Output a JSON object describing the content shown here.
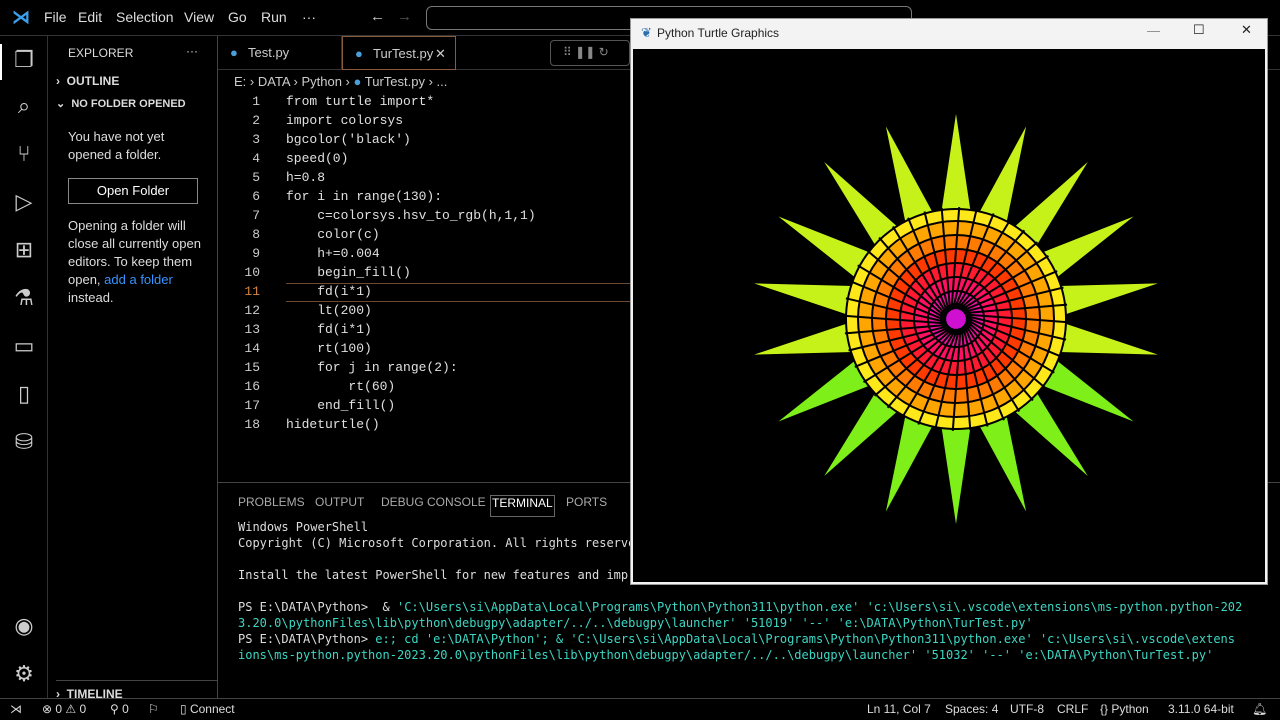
{
  "menu": [
    "File",
    "Edit",
    "Selection",
    "View",
    "Go",
    "Run",
    "···"
  ],
  "sidebar": {
    "title": "EXPLORER",
    "more": "···",
    "outline": "OUTLINE",
    "no_folder": "NO FOLDER OPENED",
    "msg1": "You have not yet opened a folder.",
    "open_folder": "Open Folder",
    "msg2_a": "Opening a folder will close all currently open editors. To keep them open,",
    "msg2_link": "add a folder",
    "msg2_b": "instead.",
    "timeline": "TIMELINE"
  },
  "tabs": [
    {
      "label": "Test.py"
    },
    {
      "label": "TurTest.py",
      "active": true
    }
  ],
  "breadcrumb": [
    "E:",
    "DATA",
    "Python",
    "TurTest.py",
    "..."
  ],
  "code": {
    "current_line": 11,
    "lines": [
      "from turtle import*",
      "import colorsys",
      "bgcolor('black')",
      "speed(0)",
      "h=0.8",
      "for i in range(130):",
      "    c=colorsys.hsv_to_rgb(h,1,1)",
      "    color(c)",
      "    h+=0.004",
      "    begin_fill()",
      "    fd(i*1)",
      "    lt(200)",
      "    fd(i*1)",
      "    rt(100)",
      "    for j in range(2):",
      "        rt(60)",
      "    end_fill()",
      "hideturtle()"
    ]
  },
  "panel": {
    "tabs": [
      "PROBLEMS",
      "OUTPUT",
      "DEBUG CONSOLE",
      "TERMINAL",
      "PORTS"
    ],
    "active": "TERMINAL"
  },
  "terminal": {
    "l1": "Windows PowerShell",
    "l2": "Copyright (C) Microsoft Corporation. All rights reserved.",
    "l3": "Install the latest PowerShell for new features and improvements! https://aka.ms/PSWindows",
    "p1": "PS E:\\DATA\\Python> ",
    "c1a": " & ",
    "c1b": "'C:\\Users\\si\\AppData\\Local\\Programs\\Python\\Python311\\python.exe' 'c:\\Users\\si\\.vscode\\extensions\\ms-python.python-202",
    "c1c": "3.20.0\\pythonFiles\\lib\\python\\debugpy\\adapter/../..\\debugpy\\launcher' '51019' '--' 'e:\\DATA\\Python\\TurTest.py'",
    "p2": "PS E:\\DATA\\Python> ",
    "c2a": "e:; cd 'e:\\DATA\\Python'; & 'C:\\Users\\si\\AppData\\Local\\Programs\\Python\\Python311\\python.exe' 'c:\\Users\\si\\.vscode\\extens",
    "c2b": "ions\\ms-python.python-2023.20.0\\pythonFiles\\lib\\python\\debugpy\\adapter/../..\\debugpy\\launcher' '51032' '--' 'e:\\DATA\\Python\\TurTest.py'"
  },
  "status": {
    "errors": "0",
    "warnings": "0",
    "ports": "0",
    "connect": "Connect",
    "position": "Ln 11, Col 7",
    "spaces": "Spaces: 4",
    "encoding": "UTF-8",
    "eol": "CRLF",
    "language": "Python",
    "interpreter": "3.11.0 64-bit"
  },
  "turtle_window": {
    "title": "Python Turtle Graphics"
  }
}
